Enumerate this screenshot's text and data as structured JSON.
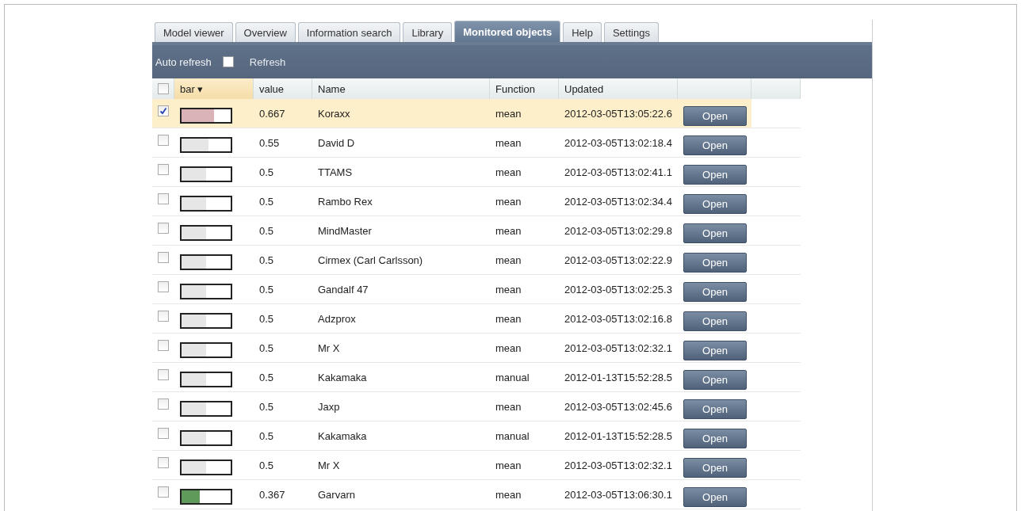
{
  "tabs": [
    {
      "label": "Model viewer",
      "selected": false
    },
    {
      "label": "Overview",
      "selected": false
    },
    {
      "label": "Information search",
      "selected": false
    },
    {
      "label": "Library",
      "selected": false
    },
    {
      "label": "Monitored objects",
      "selected": true
    },
    {
      "label": "Help",
      "selected": false
    },
    {
      "label": "Settings",
      "selected": false
    }
  ],
  "toolbar": {
    "auto_refresh": {
      "label": "Auto refresh",
      "checked": false
    },
    "refresh": "Refresh"
  },
  "table": {
    "select_all_checked": false,
    "columns": [
      "bar ▾",
      "value",
      "Name",
      "Function",
      "Updated"
    ],
    "rows": [
      {
        "checked": true,
        "selected": true,
        "bar": {
          "level": 0.667,
          "color": "#d9b3b8"
        },
        "value": "0.667",
        "name": "Koraxx",
        "function": "mean",
        "updated": "2012-03-05T13:05:22.6",
        "button": "Open"
      },
      {
        "checked": false,
        "selected": false,
        "bar": {
          "level": 0.55,
          "color": "#e6e6e6"
        },
        "value": "0.55",
        "name": "David D",
        "function": "mean",
        "updated": "2012-03-05T13:02:18.4",
        "button": "Open"
      },
      {
        "checked": false,
        "selected": false,
        "bar": {
          "level": 0.5,
          "color": "#e6e6e6"
        },
        "value": "0.5",
        "name": "TTAMS",
        "function": "mean",
        "updated": "2012-03-05T13:02:41.1",
        "button": "Open"
      },
      {
        "checked": false,
        "selected": false,
        "bar": {
          "level": 0.5,
          "color": "#e6e6e6"
        },
        "value": "0.5",
        "name": "Rambo Rex",
        "function": "mean",
        "updated": "2012-03-05T13:02:34.4",
        "button": "Open"
      },
      {
        "checked": false,
        "selected": false,
        "bar": {
          "level": 0.5,
          "color": "#e6e6e6"
        },
        "value": "0.5",
        "name": "MindMaster",
        "function": "mean",
        "updated": "2012-03-05T13:02:29.8",
        "button": "Open"
      },
      {
        "checked": false,
        "selected": false,
        "bar": {
          "level": 0.5,
          "color": "#e6e6e6"
        },
        "value": "0.5",
        "name": "Cirmex (Carl Carlsson)",
        "function": "mean",
        "updated": "2012-03-05T13:02:22.9",
        "button": "Open"
      },
      {
        "checked": false,
        "selected": false,
        "bar": {
          "level": 0.5,
          "color": "#e6e6e6"
        },
        "value": "0.5",
        "name": "Gandalf 47",
        "function": "mean",
        "updated": "2012-03-05T13:02:25.3",
        "button": "Open"
      },
      {
        "checked": false,
        "selected": false,
        "bar": {
          "level": 0.5,
          "color": "#e6e6e6"
        },
        "value": "0.5",
        "name": "Adzprox",
        "function": "mean",
        "updated": "2012-03-05T13:02:16.8",
        "button": "Open"
      },
      {
        "checked": false,
        "selected": false,
        "bar": {
          "level": 0.5,
          "color": "#e6e6e6"
        },
        "value": "0.5",
        "name": "Mr X",
        "function": "mean",
        "updated": "2012-03-05T13:02:32.1",
        "button": "Open"
      },
      {
        "checked": false,
        "selected": false,
        "bar": {
          "level": 0.5,
          "color": "#e6e6e6"
        },
        "value": "0.5",
        "name": "Kakamaka",
        "function": "manual",
        "updated": "2012-01-13T15:52:28.5",
        "button": "Open"
      },
      {
        "checked": false,
        "selected": false,
        "bar": {
          "level": 0.5,
          "color": "#e6e6e6"
        },
        "value": "0.5",
        "name": "Jaxp",
        "function": "mean",
        "updated": "2012-03-05T13:02:45.6",
        "button": "Open"
      },
      {
        "checked": false,
        "selected": false,
        "bar": {
          "level": 0.5,
          "color": "#e6e6e6"
        },
        "value": "0.5",
        "name": "Kakamaka",
        "function": "manual",
        "updated": "2012-01-13T15:52:28.5",
        "button": "Open"
      },
      {
        "checked": false,
        "selected": false,
        "bar": {
          "level": 0.5,
          "color": "#e6e6e6"
        },
        "value": "0.5",
        "name": "Mr X",
        "function": "mean",
        "updated": "2012-03-05T13:02:32.1",
        "button": "Open"
      },
      {
        "checked": false,
        "selected": false,
        "bar": {
          "level": 0.367,
          "color": "#5f9a5a"
        },
        "value": "0.367",
        "name": "Garvarn",
        "function": "mean",
        "updated": "2012-03-05T13:06:30.1",
        "button": "Open"
      }
    ]
  }
}
